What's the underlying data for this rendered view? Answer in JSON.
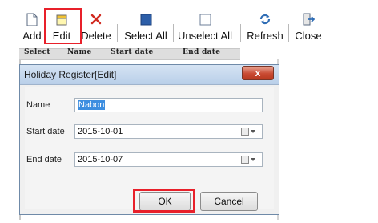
{
  "toolbar": {
    "add_label": "Add",
    "edit_label": "Edit",
    "delete_label": "Delete",
    "select_all_label": "Select All",
    "unselect_all_label": "Unselect All",
    "refresh_label": "Refresh",
    "close_label": "Close",
    "icons": {
      "add": "new-document-icon",
      "edit": "edit-document-icon",
      "delete": "red-x-icon",
      "select_all": "filled-square-icon",
      "unselect_all": "empty-square-icon",
      "refresh": "refresh-arrows-icon",
      "close": "exit-door-icon"
    }
  },
  "grid": {
    "columns": [
      "Select",
      "Name",
      "Start date",
      "End date"
    ]
  },
  "dialog": {
    "title": "Holiday Register[Edit]",
    "close_glyph": "x",
    "fields": {
      "name_label": "Name",
      "name_value": "Nabon",
      "start_label": "Start date",
      "start_value": "2015-10-01",
      "end_label": "End date",
      "end_value": "2015-10-07"
    },
    "ok_label": "OK",
    "cancel_label": "Cancel"
  },
  "colors": {
    "highlight": "#e8202a",
    "selection": "#3d8ee0",
    "close_button": "#c94b33",
    "titlebar": "#c6d9ef"
  }
}
